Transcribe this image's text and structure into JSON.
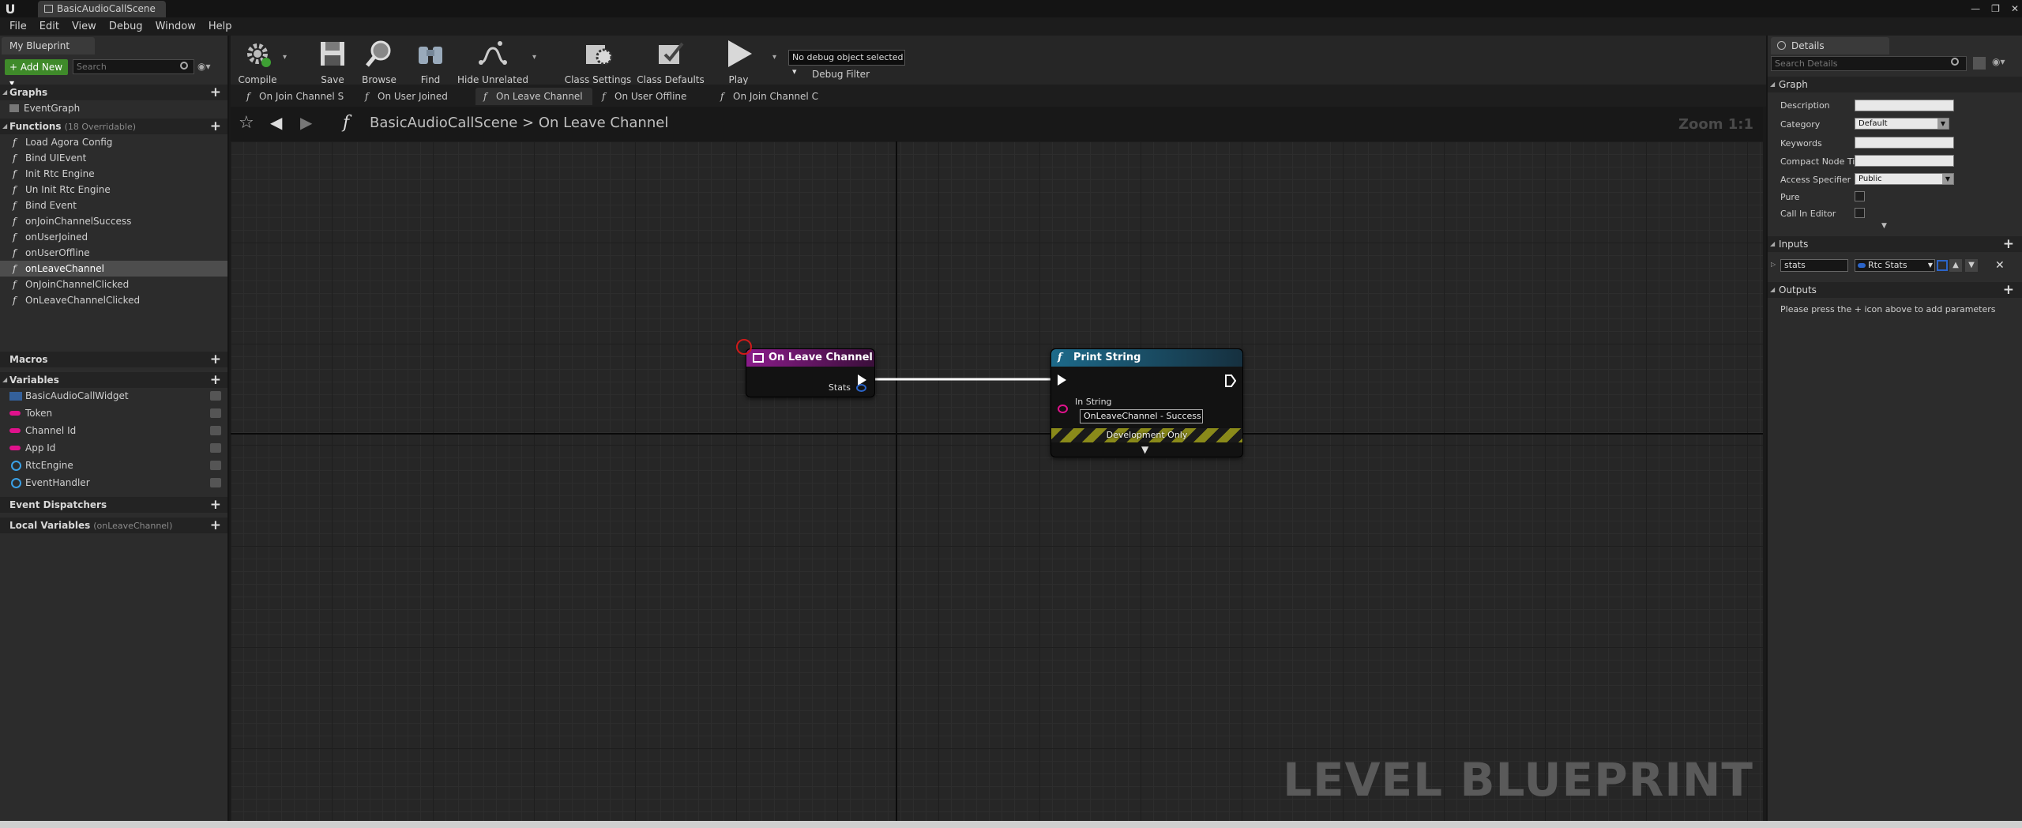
{
  "window": {
    "doc_tab": "BasicAudioCallScene",
    "min": "—",
    "max": "❐",
    "close": "✕"
  },
  "menu": [
    "File",
    "Edit",
    "View",
    "Debug",
    "Window",
    "Help"
  ],
  "left_panel": {
    "tab": "My Blueprint",
    "add_new": "+ Add New ▾",
    "search_placeholder": "Search",
    "graphs_header": "Graphs",
    "graphs": [
      "EventGraph"
    ],
    "functions_header": "Functions",
    "functions_sub": "(18 Overridable)",
    "functions": [
      "Load Agora Config",
      "Bind UIEvent",
      "Init Rtc Engine",
      "Un Init Rtc Engine",
      "Bind Event",
      "onJoinChannelSuccess",
      "onUserJoined",
      "onUserOffline",
      "onLeaveChannel",
      "OnJoinChannelClicked",
      "OnLeaveChannelClicked"
    ],
    "selected_function": "onLeaveChannel",
    "macros_header": "Macros",
    "variables_header": "Variables",
    "variables": [
      {
        "name": "BasicAudioCallWidget",
        "kind": "struct",
        "color": "#34609a"
      },
      {
        "name": "Token",
        "kind": "string",
        "color": "#e0128c"
      },
      {
        "name": "Channel Id",
        "kind": "string",
        "color": "#e0128c"
      },
      {
        "name": "App Id",
        "kind": "string",
        "color": "#e0128c"
      },
      {
        "name": "RtcEngine",
        "kind": "object",
        "color": "#3aa0e6"
      },
      {
        "name": "EventHandler",
        "kind": "object",
        "color": "#3aa0e6"
      }
    ],
    "dispatchers_header": "Event Dispatchers",
    "locals_header": "Local Variables",
    "locals_sub": "(onLeaveChannel)"
  },
  "toolbar": {
    "compile": "Compile",
    "save": "Save",
    "browse": "Browse",
    "find": "Find",
    "hide_unrelated": "Hide Unrelated",
    "class_settings": "Class Settings",
    "class_defaults": "Class Defaults",
    "play": "Play",
    "debug_select": "No debug object selected ▾",
    "debug_filter": "Debug Filter"
  },
  "graph_tabs": [
    "On Join Channel S",
    "On User Joined",
    "On Leave Channel",
    "On User Offline",
    "On Join Channel C"
  ],
  "active_graph_tab": "On Leave Channel",
  "breadcrumb": {
    "root": "BasicAudioCallScene",
    "sep": ">",
    "current": "On Leave Channel",
    "zoom": "Zoom 1:1"
  },
  "graph": {
    "entry_node": {
      "title": "On Leave Channel",
      "pin": "Stats",
      "header_color": "#8a1c8a"
    },
    "print_node": {
      "title": "Print String",
      "pin": "In String",
      "value": "OnLeaveChannel - Success",
      "footer": "Development Only",
      "header_color": "#1d6a8a"
    },
    "watermark": "LEVEL BLUEPRINT"
  },
  "right_panel": {
    "tab": "Details",
    "search_placeholder": "Search Details",
    "graph_header": "Graph",
    "props": {
      "description": "Description",
      "category": "Category",
      "category_value": "Default",
      "keywords": "Keywords",
      "compact_title": "Compact Node Ti",
      "access": "Access Specifier",
      "access_value": "Public",
      "pure": "Pure",
      "call_in_editor": "Call In Editor"
    },
    "inputs_header": "Inputs",
    "input_name": "stats",
    "input_type": "Rtc Stats",
    "outputs_header": "Outputs",
    "outputs_note": "Please press the + icon above to add parameters"
  }
}
